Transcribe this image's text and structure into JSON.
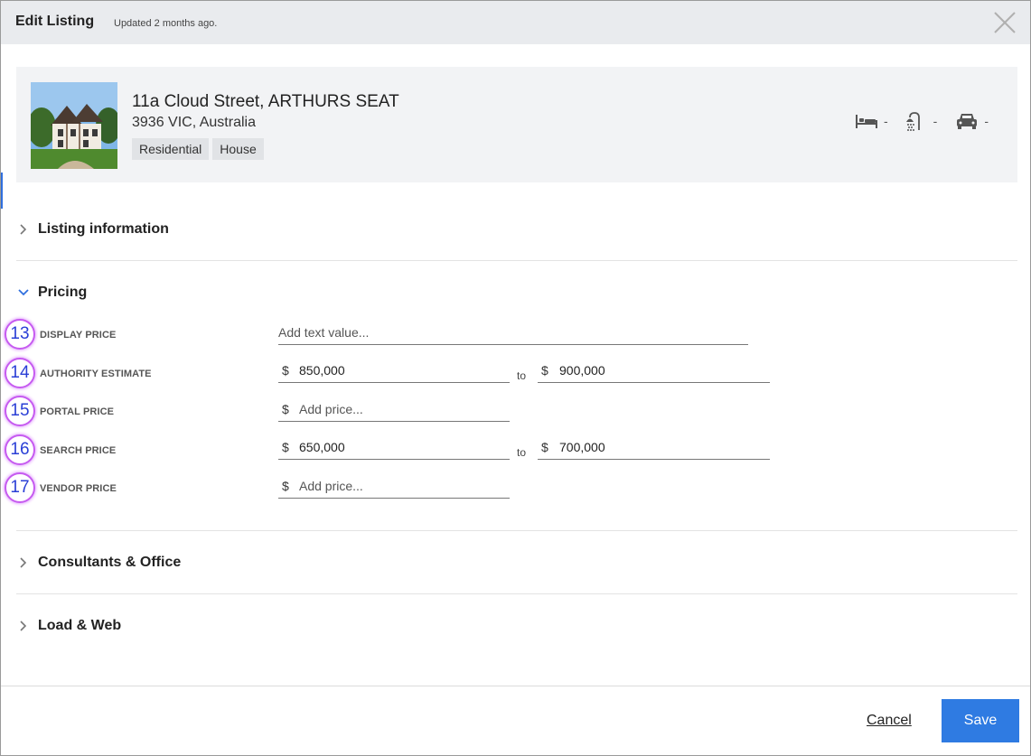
{
  "header": {
    "title": "Edit Listing",
    "updated": "Updated 2 months ago."
  },
  "property": {
    "address": "11a Cloud Street, ARTHURS SEAT",
    "suburb": "3936 VIC, Australia",
    "tags": [
      "Residential",
      "House"
    ],
    "features": {
      "beds": "-",
      "baths": "-",
      "cars": "-"
    }
  },
  "sections": {
    "listing_information": "Listing information",
    "pricing": "Pricing",
    "consultants_office": "Consultants & Office",
    "load_web": "Load & Web"
  },
  "pricing": {
    "display_price": {
      "badge": "13",
      "label": "DISPLAY PRICE",
      "placeholder": "Add text value..."
    },
    "authority_estimate": {
      "badge": "14",
      "label": "AUTHORITY ESTIMATE",
      "currency": "$",
      "from": "850,000",
      "to_label": "to",
      "to": "900,000"
    },
    "portal_price": {
      "badge": "15",
      "label": "PORTAL PRICE",
      "currency": "$",
      "placeholder": "Add price..."
    },
    "search_price": {
      "badge": "16",
      "label": "SEARCH PRICE",
      "currency": "$",
      "from": "650,000",
      "to_label": "to",
      "to": "700,000"
    },
    "vendor_price": {
      "badge": "17",
      "label": "VENDOR PRICE",
      "currency": "$",
      "placeholder": "Add price..."
    }
  },
  "footer": {
    "cancel_label": "Cancel",
    "save_label": "Save"
  },
  "colors": {
    "header_bg": "#e9ebee",
    "card_bg": "#f2f3f5",
    "accent": "#2f7be2",
    "badge_border": "#c65bf0",
    "badge_text": "#2a3fd6"
  },
  "icons": {
    "close": "close-icon",
    "bed": "bed-icon",
    "shower": "shower-icon",
    "car": "car-icon",
    "chevron_right": "chevron-right-icon",
    "chevron_down": "chevron-down-icon"
  }
}
